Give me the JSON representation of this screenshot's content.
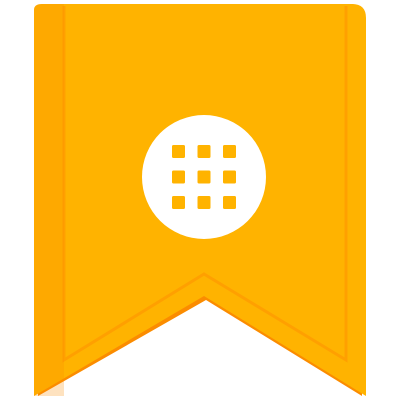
{
  "icon": {
    "name": "bookmark-apps-icon",
    "shape": "bookmark-ribbon",
    "glyph": "apps-grid-icon",
    "grid_rows": 3,
    "grid_cols": 3
  },
  "colors": {
    "ribbon_fill": "#FFB300",
    "ribbon_edge": "#FFA000",
    "ribbon_shadow": "#FB8C00",
    "emblem_fill": "#FFFFFF",
    "grid_dot": "#FFB300"
  }
}
